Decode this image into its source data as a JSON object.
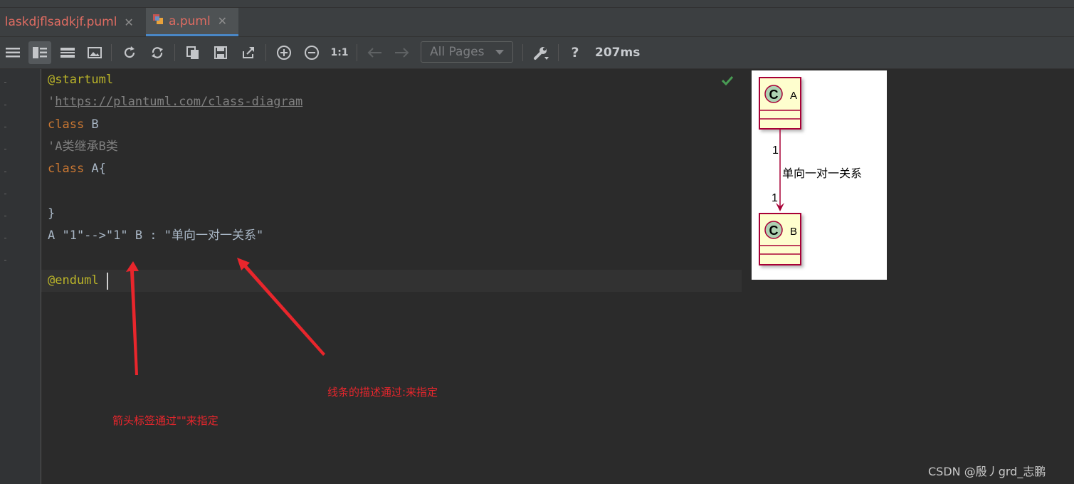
{
  "tabs": [
    {
      "label": "laskdjflsadkjf.puml",
      "active": false
    },
    {
      "label": "a.puml",
      "active": true
    }
  ],
  "toolbar": {
    "pages_select": "All Pages",
    "zoom_one_to_one": "1:1",
    "help": "?",
    "render_time": "207ms"
  },
  "code_lines": [
    {
      "parts": [
        {
          "text": "@startuml",
          "style": "ann"
        }
      ]
    },
    {
      "parts": [
        {
          "text": "'",
          "style": "cm"
        },
        {
          "text": "https://plantuml.com/class-diagram",
          "style": "lnk"
        }
      ]
    },
    {
      "parts": [
        {
          "text": "class ",
          "style": "kw"
        },
        {
          "text": "B",
          "style": "id"
        }
      ]
    },
    {
      "parts": [
        {
          "text": "'A类继承B类",
          "style": "cm"
        }
      ]
    },
    {
      "parts": [
        {
          "text": "class ",
          "style": "kw"
        },
        {
          "text": "A{",
          "style": "id"
        }
      ]
    },
    {
      "parts": []
    },
    {
      "parts": [
        {
          "text": "}",
          "style": "id"
        }
      ]
    },
    {
      "parts": [
        {
          "text": "A \"1\"-->\"1\" B : \"单向一对一关系\"",
          "style": "id"
        }
      ]
    },
    {
      "parts": []
    },
    {
      "parts": [
        {
          "text": "@enduml",
          "style": "ann"
        }
      ]
    }
  ],
  "diagram": {
    "class_a": {
      "stereotype": "C",
      "name": "A"
    },
    "class_b": {
      "stereotype": "C",
      "name": "B"
    },
    "source_multiplicity": "1",
    "target_multiplicity": "1",
    "relation_label": "单向一对一关系",
    "colors": {
      "class_fill": "#fefece",
      "border": "#a80036",
      "circle_fill": "#add1b2"
    }
  },
  "annotations": {
    "arrow_label_note": "箭头标签通过\"\"来指定",
    "line_desc_note": "线条的描述通过:来指定",
    "color": "#e8262c"
  },
  "watermark": "CSDN @殷丿grd_志鹏"
}
